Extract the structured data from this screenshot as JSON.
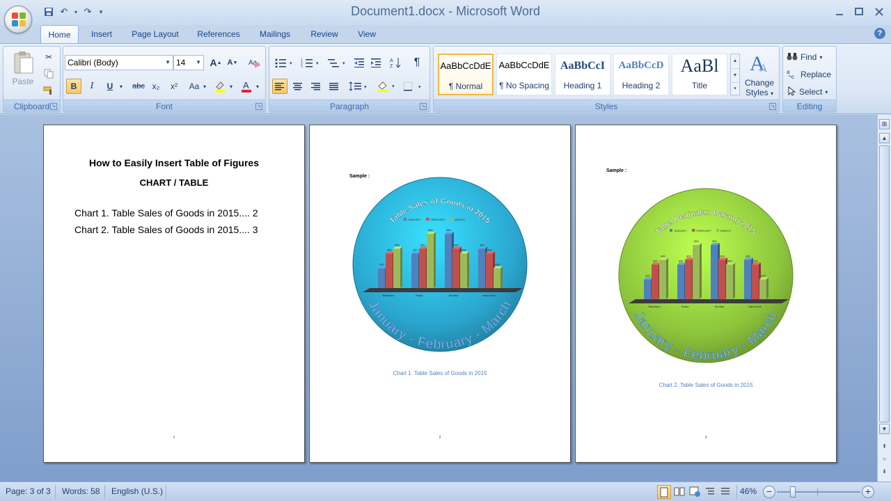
{
  "window": {
    "title": "Document1.docx - Microsoft Word"
  },
  "tabs": [
    {
      "label": "Home",
      "active": true
    },
    {
      "label": "Insert"
    },
    {
      "label": "Page Layout"
    },
    {
      "label": "References"
    },
    {
      "label": "Mailings"
    },
    {
      "label": "Review"
    },
    {
      "label": "View"
    }
  ],
  "ribbon": {
    "clipboard": {
      "label": "Clipboard",
      "paste": "Paste"
    },
    "font": {
      "label": "Font",
      "family": "Calibri (Body)",
      "size": "14",
      "bold": "B",
      "italic": "I",
      "underline": "U",
      "strike": "abc",
      "sub": "x₂",
      "sup": "x²",
      "case": "Aa",
      "grow": "A",
      "shrink": "A"
    },
    "paragraph": {
      "label": "Paragraph",
      "pilcrow": "¶"
    },
    "styles": {
      "label": "Styles",
      "items": [
        {
          "sample": "AaBbCcDdE",
          "name": "¶ Normal"
        },
        {
          "sample": "AaBbCcDdE",
          "name": "¶ No Spacing"
        },
        {
          "sample": "AaBbCcI",
          "name": "Heading 1"
        },
        {
          "sample": "AaBbCcD",
          "name": "Heading 2"
        },
        {
          "sample": "AaBl",
          "name": "Title"
        }
      ],
      "change_styles": "Change Styles"
    },
    "editing": {
      "label": "Editing",
      "find": "Find",
      "replace": "Replace",
      "select": "Select"
    }
  },
  "pages": {
    "p1": {
      "title": "How to Easily Insert Table of Figures",
      "subtitle": "CHART / TABLE",
      "entries": [
        "Chart 1. Table Sales of Goods in 2015.... 2",
        "Chart 2. Table Sales of Goods in 2015.... 3"
      ],
      "number": "1"
    },
    "p2": {
      "sample": "Sample :",
      "chart_title": "Table Sales of Goods in 2015",
      "arc_text": "January - February - March",
      "caption": "Chart 1. Table Sales of Goods in 2015",
      "number": "2"
    },
    "p3": {
      "sample": "Sample :",
      "chart_title": "Tabel Penjualan Barang 2015",
      "arc_text": "January - February - March",
      "caption": "Chart 2. Table Sales of Goods in 2015",
      "number": "3"
    }
  },
  "chart_data": [
    {
      "type": "bar",
      "title": "Table Sales of Goods in 2015",
      "categories": [
        "Television",
        "Radio",
        "Monitor",
        "Hard Drive"
      ],
      "series": [
        {
          "name": "JANUARY",
          "values": [
            200,
            350,
            550,
            400
          ],
          "color": "#4f81bd"
        },
        {
          "name": "FEBRUARY",
          "values": [
            350,
            400,
            400,
            350
          ],
          "color": "#c0504d"
        },
        {
          "name": "MARCH",
          "values": [
            400,
            550,
            350,
            200
          ],
          "color": "#9bbb59"
        }
      ],
      "ylim": [
        0,
        600
      ],
      "legend": "top",
      "background": "#2aa6cf"
    },
    {
      "type": "bar",
      "title": "Tabel Penjualan Barang 2015",
      "categories": [
        "Television",
        "Radio",
        "Monitor",
        "Hard Drive"
      ],
      "series": [
        {
          "name": "JANUARY",
          "values": [
            200,
            350,
            550,
            400
          ],
          "color": "#4f81bd"
        },
        {
          "name": "FEBRUARY",
          "values": [
            350,
            400,
            400,
            350
          ],
          "color": "#c0504d"
        },
        {
          "name": "MARCH",
          "values": [
            400,
            550,
            350,
            200
          ],
          "color": "#9bbb59"
        }
      ],
      "ylim": [
        0,
        600
      ],
      "legend": "top",
      "background": "#8cc43c"
    }
  ],
  "status": {
    "page": "Page: 3 of 3",
    "words": "Words: 58",
    "language": "English (U.S.)",
    "zoom": "46%"
  }
}
